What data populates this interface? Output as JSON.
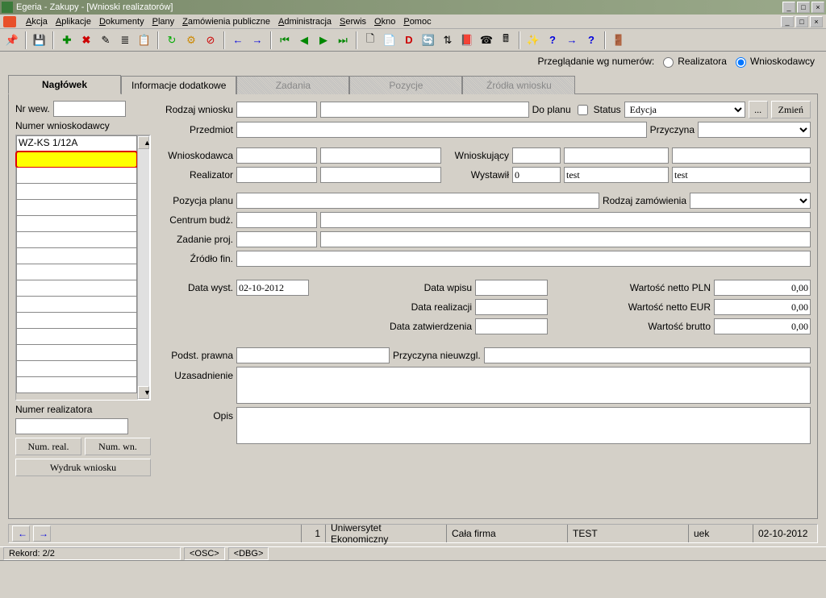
{
  "window": {
    "title": "Egeria - Zakupy - [Wnioski realizatorów]"
  },
  "menu": [
    "Akcja",
    "Aplikacje",
    "Dokumenty",
    "Plany",
    "Zamówienia publiczne",
    "Administracja",
    "Serwis",
    "Okno",
    "Pomoc"
  ],
  "filter": {
    "label": "Przeglądanie wg numerów:",
    "opt1": "Realizatora",
    "opt2": "Wnioskodawcy"
  },
  "tabs": [
    "Nagłówek",
    "Informacje dodatkowe",
    "Zadania",
    "Pozycje",
    "Źródła wniosku"
  ],
  "left": {
    "nr_wew_label": "Nr wew.",
    "nr_wew_value": "",
    "numer_wnio_label": "Numer wnioskodawcy",
    "list": [
      "WZ-KS 1/12A",
      "",
      "",
      "",
      "",
      "",
      "",
      "",
      "",
      "",
      "",
      "",
      "",
      "",
      "",
      "",
      ""
    ],
    "numer_real_label": "Numer realizatora",
    "numer_real_value": "",
    "btn_num_real": "Num. real.",
    "btn_num_wn": "Num. wn.",
    "btn_wydruk": "Wydruk wniosku"
  },
  "form": {
    "rodzaj_wniosku": {
      "label": "Rodzaj wniosku",
      "v": ""
    },
    "do_planu": {
      "label": "Do planu"
    },
    "status": {
      "label": "Status",
      "v": "Edycja",
      "btn_dots": "...",
      "btn_zmien": "Zmień"
    },
    "przedmiot": {
      "label": "Przedmiot",
      "v": ""
    },
    "przyczyna": {
      "label": "Przyczyna",
      "v": ""
    },
    "wnioskodawca": {
      "label": "Wnioskodawca",
      "v1": "",
      "v2": ""
    },
    "wnioskujacy": {
      "label": "Wnioskujący",
      "v1": "",
      "v2": "",
      "v3": ""
    },
    "realizator": {
      "label": "Realizator",
      "v1": "",
      "v2": ""
    },
    "wystawil": {
      "label": "Wystawił",
      "v1": "0",
      "v2": "test",
      "v3": "test"
    },
    "pozycja_planu": {
      "label": "Pozycja planu",
      "v": ""
    },
    "rodzaj_zam": {
      "label": "Rodzaj zamówienia",
      "v": ""
    },
    "centrum": {
      "label": "Centrum budż.",
      "v1": "",
      "v2": ""
    },
    "zadanie": {
      "label": "Zadanie proj.",
      "v1": "",
      "v2": ""
    },
    "zrodlo": {
      "label": "Źródło fin.",
      "v": ""
    },
    "data_wyst": {
      "label": "Data wyst.",
      "v": "02-10-2012"
    },
    "data_wpisu": {
      "label": "Data wpisu",
      "v": ""
    },
    "data_realiz": {
      "label": "Data realizacji",
      "v": ""
    },
    "data_zatw": {
      "label": "Data zatwierdzenia",
      "v": ""
    },
    "wart_netto_pln": {
      "label": "Wartość netto PLN",
      "v": "0,00"
    },
    "wart_netto_eur": {
      "label": "Wartość netto EUR",
      "v": "0,00"
    },
    "wart_brutto": {
      "label": "Wartość brutto",
      "v": "0,00"
    },
    "podst_prawna": {
      "label": "Podst. prawna",
      "v": ""
    },
    "przyczyna_nieuw": {
      "label": "Przyczyna nieuwzgl.",
      "v": ""
    },
    "uzasadnienie": {
      "label": "Uzasadnienie",
      "v": ""
    },
    "opis": {
      "label": "Opis",
      "v": ""
    }
  },
  "status_row": {
    "num": "1",
    "c1": "Uniwersytet Ekonomiczny",
    "c2": "Cała firma",
    "c3": "TEST",
    "c4": "uek",
    "c5": "02-10-2012"
  },
  "bottom": {
    "rekord": "Rekord: 2/2",
    "osc": "<OSC>",
    "dbg": "<DBG>"
  }
}
